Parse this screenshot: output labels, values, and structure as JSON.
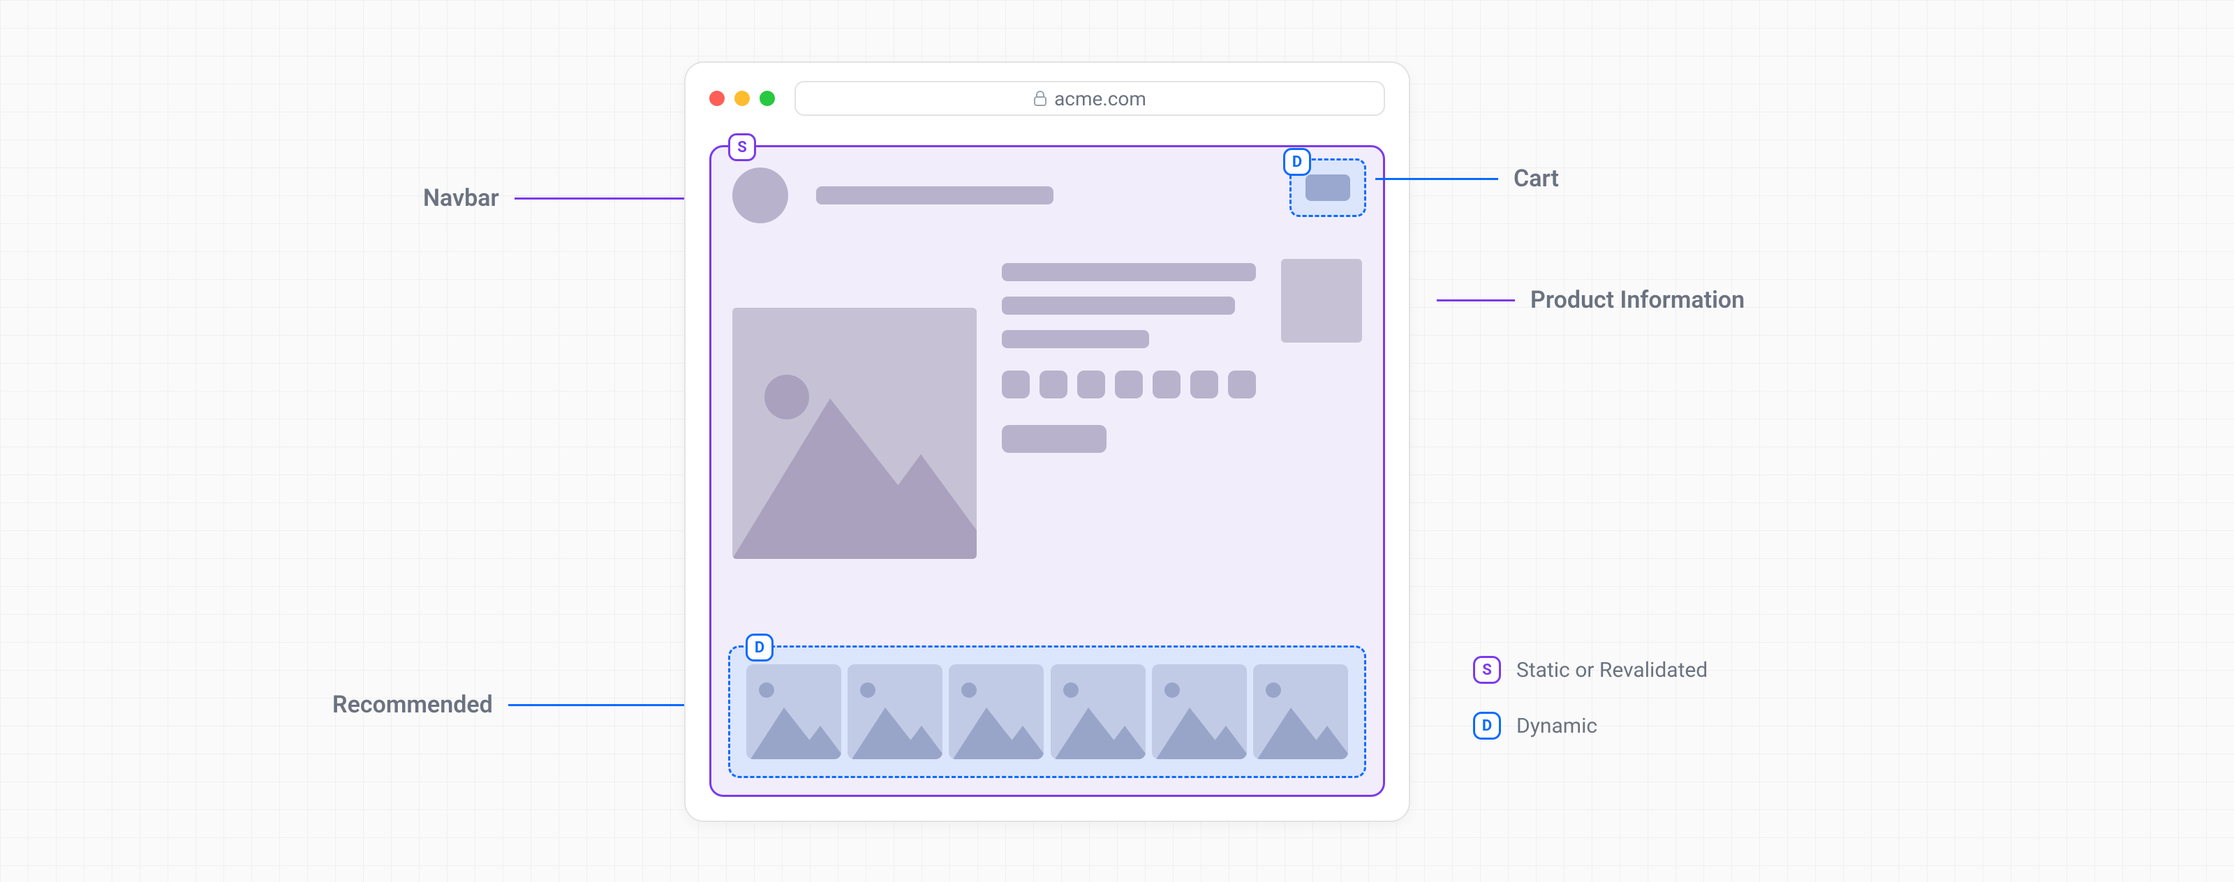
{
  "browser": {
    "url": "acme.com"
  },
  "badges": {
    "static_letter": "S",
    "dynamic_letter": "D"
  },
  "callouts": {
    "navbar": "Navbar",
    "cart": "Cart",
    "product": "Product Information",
    "recommended": "Recommended"
  },
  "legend": {
    "static": "Static or Revalidated",
    "dynamic": "Dynamic"
  },
  "recommended": {
    "card_count": 6
  },
  "product": {
    "chip_count": 7
  },
  "colors": {
    "static_border": "#7c3aed",
    "dynamic_border": "#0b6bff"
  }
}
